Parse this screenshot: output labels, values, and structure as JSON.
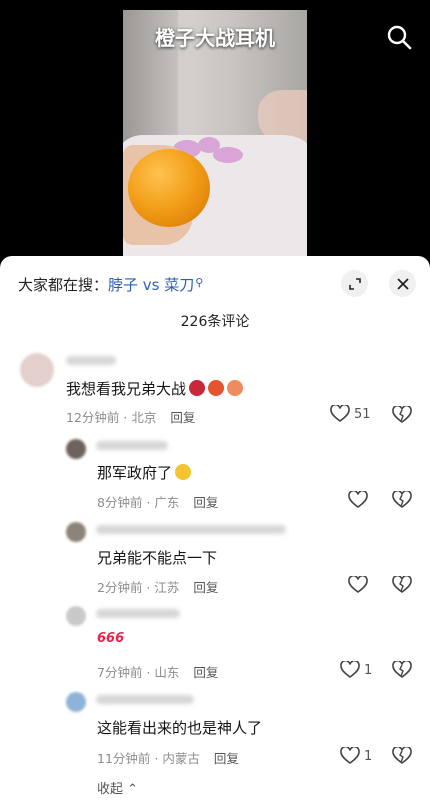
{
  "video": {
    "title": "橙子大战耳机"
  },
  "sheet": {
    "hot_search_prefix": "大家都在搜：",
    "hot_search_term": "脖子 vs 菜刀",
    "comment_count": "226条评论",
    "collapse_label": "收起"
  },
  "comments": [
    {
      "text": "我想看我兄弟大战",
      "meta": "12分钟前 · 北京",
      "reply": "回复",
      "likes": "51"
    },
    {
      "text": "那军政府了",
      "meta": "8分钟前 · 广东",
      "reply": "回复",
      "likes": ""
    },
    {
      "text": "兄弟能不能点一下",
      "meta": "2分钟前 · 江苏",
      "reply": "回复",
      "likes": ""
    },
    {
      "text": "666",
      "meta": "7分钟前 · 山东",
      "reply": "回复",
      "likes": "1"
    },
    {
      "text": "这能看出来的也是神人了",
      "meta": "11分钟前 · 内蒙古",
      "reply": "回复",
      "likes": "1"
    }
  ],
  "colors": {
    "accent_link": "#2b5fb3",
    "orange": "#f3a01a"
  },
  "icons": [
    "search-icon",
    "expand-icon",
    "close-icon",
    "heart-icon",
    "broken-heart-icon"
  ]
}
